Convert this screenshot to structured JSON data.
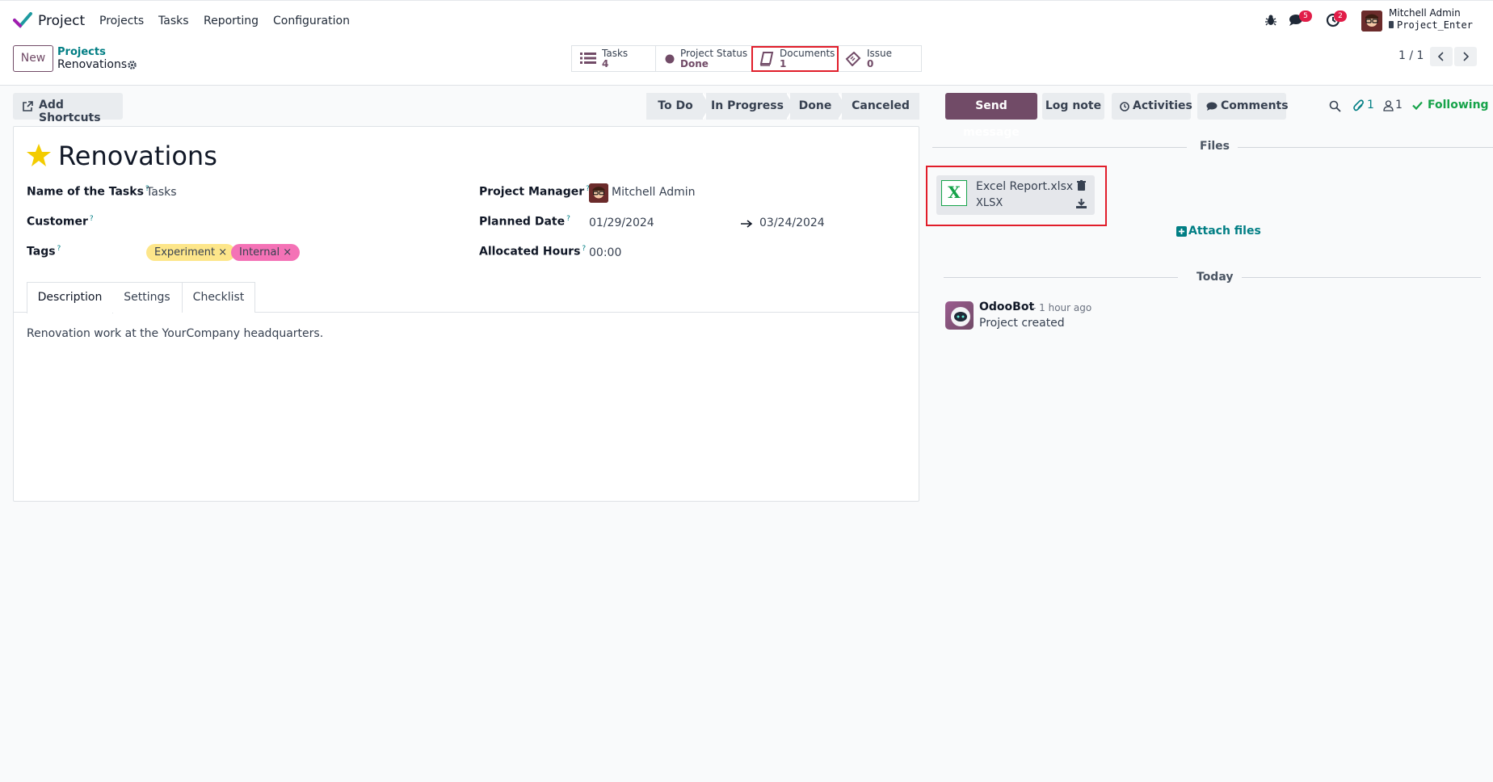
{
  "app": {
    "name": "Project"
  },
  "nav": {
    "items": [
      "Projects",
      "Tasks",
      "Reporting",
      "Configuration"
    ]
  },
  "systray": {
    "messages_count": "5",
    "activities_count": "2",
    "user_name": "Mitchell Admin",
    "database": "Project_Enter"
  },
  "control": {
    "new_label": "New",
    "breadcrumb_parent": "Projects",
    "breadcrumb_current": "Renovations",
    "pager": "1 / 1"
  },
  "smart_buttons": [
    {
      "label": "Tasks",
      "value": "4",
      "icon": "tasks-icon"
    },
    {
      "label": "Project Status",
      "value": "Done",
      "icon": "status-dot-icon"
    },
    {
      "label": "Documents",
      "value": "1",
      "icon": "book-icon"
    },
    {
      "label": "Issue",
      "value": "0",
      "icon": "ticket-icon"
    }
  ],
  "actions": {
    "add_shortcuts": "Add Shortcuts"
  },
  "stages": [
    "To Do",
    "In Progress",
    "Done",
    "Canceled"
  ],
  "form": {
    "title": "Renovations",
    "favorite": true,
    "fields": {
      "name_of_tasks_label": "Name of the Tasks",
      "name_of_tasks_value": "Tasks",
      "customer_label": "Customer",
      "customer_value": "",
      "tags_label": "Tags",
      "tags": [
        {
          "name": "Experiment",
          "color": "#fde68a"
        },
        {
          "name": "Internal",
          "color": "#f472b6"
        }
      ],
      "project_manager_label": "Project Manager",
      "project_manager_value": "Mitchell Admin",
      "planned_date_label": "Planned Date",
      "planned_date_start": "01/29/2024",
      "planned_date_end": "03/24/2024",
      "allocated_hours_label": "Allocated Hours",
      "allocated_hours_value": "00:00"
    },
    "tabs": [
      "Description",
      "Settings",
      "Checklist"
    ],
    "active_tab": "Description",
    "description": "Renovation work at the YourCompany headquarters."
  },
  "chatter": {
    "send_message": "Send message",
    "log_note": "Log note",
    "activities": "Activities",
    "comments": "Comments",
    "attachments_count": "1",
    "followers_count": "1",
    "following_label": "Following",
    "files_header": "Files",
    "file": {
      "name": "Excel Report.xlsx",
      "ext": "XLSX",
      "icon_letter": "X"
    },
    "attach_label": "Attach files",
    "today_header": "Today",
    "message": {
      "author": "OdooBot",
      "time": "- 1 hour ago",
      "body": "Project created"
    }
  },
  "colors": {
    "brand": "#714b67",
    "link": "#017e84",
    "following": "#16a34a",
    "highlight": "#e11d2a"
  }
}
